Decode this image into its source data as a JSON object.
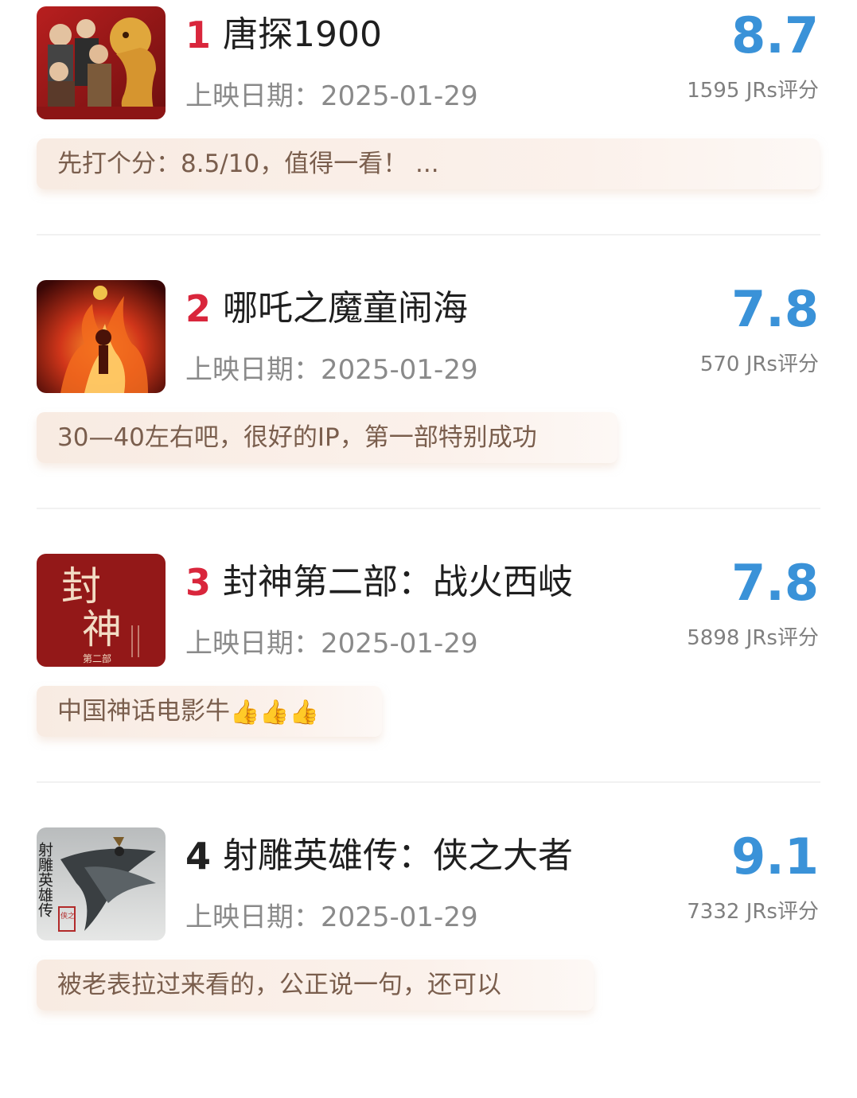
{
  "release_prefix": "上映日期：",
  "ratings_suffix": "评分",
  "movies": [
    {
      "rank": "1",
      "title": "唐探1900",
      "release_date": "2025-01-29",
      "score": "8.7",
      "ratings_count": "1595 JRs",
      "comment": "先打个分：8.5/10，值得一看！ ...",
      "poster_icon": "poster-tangtan-1900-icon"
    },
    {
      "rank": "2",
      "title": "哪吒之魔童闹海",
      "release_date": "2025-01-29",
      "score": "7.8",
      "ratings_count": "570 JRs",
      "comment": "30—40左右吧，很好的IP，第一部特别成功",
      "poster_icon": "poster-nezha-icon"
    },
    {
      "rank": "3",
      "title": "封神第二部：战火西岐",
      "release_date": "2025-01-29",
      "score": "7.8",
      "ratings_count": "5898 JRs",
      "comment": "中国神话电影牛",
      "comment_thumbs": "👍👍👍",
      "poster_icon": "poster-fengshen-icon",
      "poster_text": {
        "big1": "封",
        "big2": "神",
        "small": "第二部"
      }
    },
    {
      "rank": "4",
      "title": "射雕英雄传：侠之大者",
      "release_date": "2025-01-29",
      "score": "9.1",
      "ratings_count": "7332 JRs",
      "comment": "被老表拉过来看的，公正说一句，还可以",
      "poster_icon": "poster-shediao-icon",
      "poster_text": {
        "vertical": "射雕英雄传",
        "seal": "侠之"
      }
    }
  ],
  "colors": {
    "top_rank": "#d9263c",
    "normal_rank": "#222222",
    "score": "#3a92d8",
    "comment_bg": "#f8ebe2",
    "comment_text": "#7a5e4d"
  }
}
